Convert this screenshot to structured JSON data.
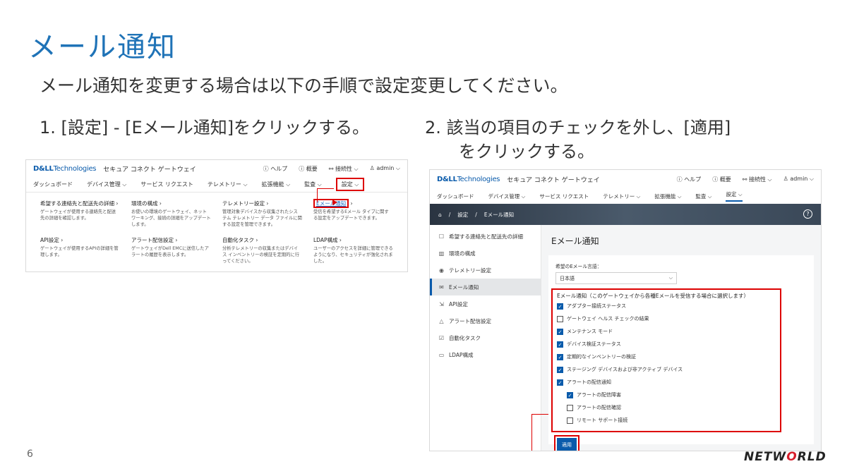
{
  "slide": {
    "title": "メール通知",
    "subtitle": "メール通知を変更する場合は以下の手順で設定変更してください。",
    "step1": "1.  [設定] - [Eメール通知]をクリックする。",
    "step2_line1": "2.  該当の項目のチェックを外し、[適用]",
    "step2_line2": "をクリックする。",
    "page_number": "6",
    "logo": {
      "prefix": "NETW",
      "o": "O",
      "suffix": "RLD"
    }
  },
  "app": {
    "brand_dell": "D&LL",
    "brand_tech": "Technologies",
    "app_name": "セキュア コネクト ゲートウェイ",
    "help": "ヘルプ",
    "about": "概要",
    "connectivity": "接続性",
    "user": "admin"
  },
  "nav": {
    "dashboard": "ダッシュボード",
    "device_mgmt": "デバイス管理",
    "service_request": "サービス リクエスト",
    "telemetry": "テレメトリー",
    "extensions": "拡張機能",
    "audit": "監査",
    "settings": "設定"
  },
  "mega_menu": [
    {
      "title": "希望する連絡先と配送先の詳細",
      "desc": "ゲートウェイが使用する連絡先と配送先の詳細を確認します。"
    },
    {
      "title": "環境の構成",
      "desc": "お使いの環境のゲートウェイ、ネットワーキング、接続の詳細をアップデートします。"
    },
    {
      "title": "テレメトリー設定",
      "desc": "管理対象デバイスから収集されたシステム テレメトリー データ ファイルに関する設定を管理できます。"
    },
    {
      "title": "Eメール通知",
      "desc": "受信を希望するEメール タイプに関する設定をアップデートできます。"
    },
    {
      "title": "API設定",
      "desc": "ゲートウェイが使用するAPIの詳細を管理します。"
    },
    {
      "title": "アラート配信設定",
      "desc": "ゲートウェイがDell EMCに送信したアラートの履歴を表示します。"
    },
    {
      "title": "自動化タスク",
      "desc": "分析テレメトリーの収集またはデバイス インベントリーの検証を定期的に行ってください。"
    },
    {
      "title": "LDAP構成",
      "desc": "ユーザーのアクセスを詳細に管理できるようになり、セキュリティが強化されました。"
    }
  ],
  "breadcrumb": {
    "home": "⌂",
    "sep": "/",
    "settings": "設定",
    "current": "Eメール通知"
  },
  "sidebar": [
    {
      "icon": "☐",
      "label": "希望する連絡先と配送先の詳細"
    },
    {
      "icon": "▥",
      "label": "環境の構成"
    },
    {
      "icon": "◉",
      "label": "テレメトリー設定"
    },
    {
      "icon": "✉",
      "label": "Eメール通知"
    },
    {
      "icon": "⇲",
      "label": "API設定"
    },
    {
      "icon": "△",
      "label": "アラート配信設定"
    },
    {
      "icon": "☑",
      "label": "自動化タスク"
    },
    {
      "icon": "▭",
      "label": "LDAP構成"
    }
  ],
  "email_page": {
    "title": "Eメール通知",
    "lang_label": "希望のEメール言語：",
    "lang_value": "日本語",
    "notify_header": "Eメール通知（このゲートウェイから各種Eメールを受信する場合に選択します）",
    "options": [
      {
        "label": "アダプター接続ステータス",
        "checked": true,
        "indent": false
      },
      {
        "label": "ゲートウェイ ヘルス チェックの結果",
        "checked": false,
        "indent": false
      },
      {
        "label": "メンテナンス モード",
        "checked": true,
        "indent": false
      },
      {
        "label": "デバイス検証ステータス",
        "checked": true,
        "indent": false
      },
      {
        "label": "定期的なインベントリーの検証",
        "checked": true,
        "indent": false
      },
      {
        "label": "ステージング デバイスおよび非アクティブ デバイス",
        "checked": true,
        "indent": false
      },
      {
        "label": "アラートの配信通知",
        "checked": true,
        "indent": false
      },
      {
        "label": "アラートの配信障害",
        "checked": true,
        "indent": true
      },
      {
        "label": "アラートの配信確認",
        "checked": false,
        "indent": true
      },
      {
        "label": "リモート サポート接続",
        "checked": false,
        "indent": true
      }
    ],
    "apply_label": "適用"
  },
  "colors": {
    "title_blue": "#1f73b7",
    "dell_blue": "#0a5bab",
    "highlight_red": "#dd0000"
  }
}
